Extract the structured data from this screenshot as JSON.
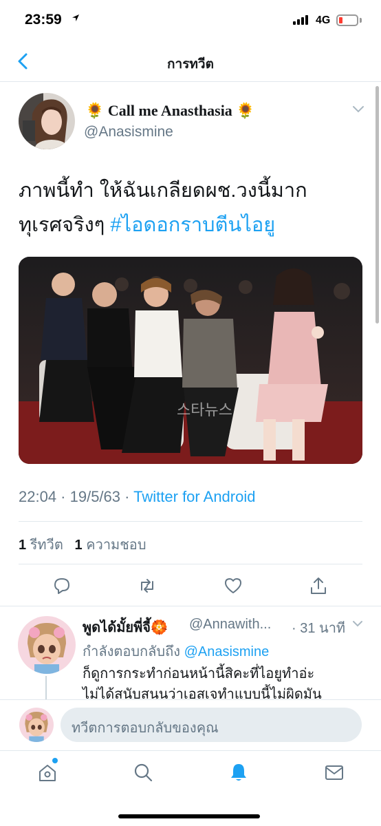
{
  "status_bar": {
    "time": "23:59",
    "network": "4G",
    "battery_color": "#ff3b30"
  },
  "nav": {
    "title": "การทวีต",
    "back_icon": "chevron-left-icon"
  },
  "tweet": {
    "display_name": "🌻 Call me Anasthasia 🌻",
    "handle": "@Anasismine",
    "text_line1": "ภาพนี้ทำ ให้ฉันเกลียดผช.วงนี้มาก",
    "text_line2_plain": "ทุเรศจริงๆ ",
    "hashtag": "#ไอดอกราบตีนไอยู",
    "photo_watermark": "스타뉴스",
    "timestamp": "22:04 · 19/5/63 · ",
    "source": "Twitter for Android",
    "retweet_count": "1",
    "retweet_label": "รีทวีต",
    "like_count": "1",
    "like_label": "ความชอบ"
  },
  "reply": {
    "display_name": "พูดได้มั้ยพี่จี้🏵️",
    "handle": "@Annawith...",
    "time": "· 31 นาที",
    "replying_to_prefix": "กำลังตอบกลับถึง ",
    "replying_to_handle": "@Anasismine",
    "text_line1": "ก็ดูการกระทำก่อนหน้านี้สิคะที่ไอยูทำอ่ะ",
    "text_line2": "ไม่ได้สนับสนุนว่าเอสเจทำแบบนี้ไม่ผิดมัน"
  },
  "composer": {
    "placeholder": "ทวีตการตอบกลับของคุณ"
  },
  "colors": {
    "accent": "#1da1f2",
    "secondary_text": "#657786",
    "divider": "#e1e8ed"
  }
}
